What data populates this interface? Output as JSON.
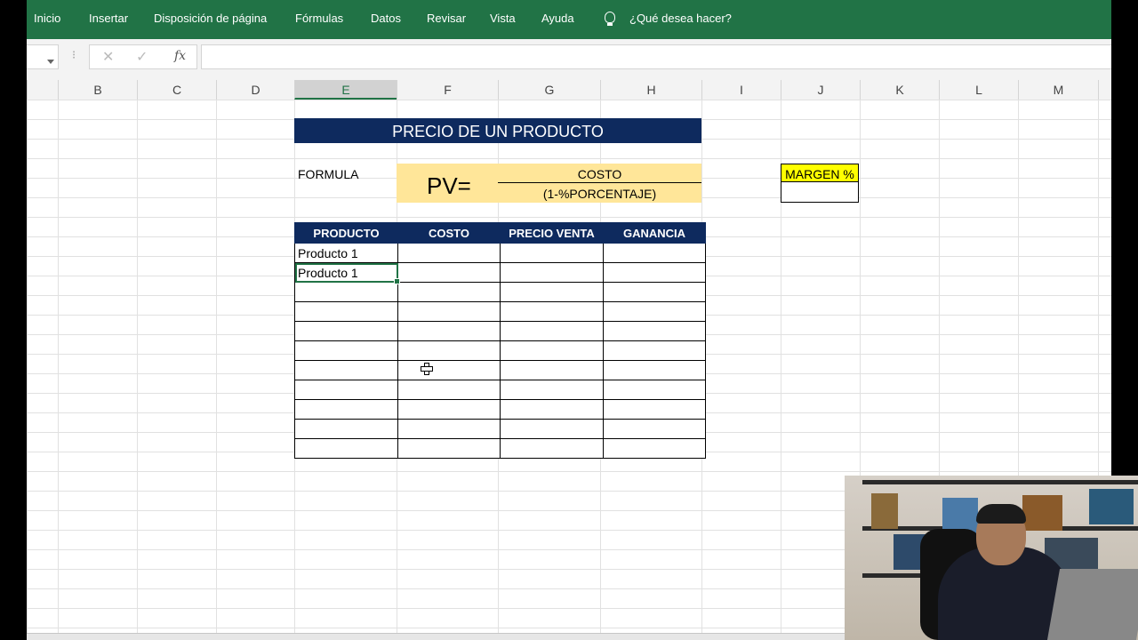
{
  "ribbon": {
    "tabs": [
      "Inicio",
      "Insertar",
      "Disposición de página",
      "Fórmulas",
      "Datos",
      "Revisar",
      "Vista",
      "Ayuda"
    ],
    "tell_me": "¿Qué desea hacer?"
  },
  "formula_bar": {
    "cancel_symbol": "✕",
    "enter_symbol": "✓",
    "fx_label": "fx",
    "value": ""
  },
  "columns": [
    "B",
    "C",
    "D",
    "E",
    "F",
    "G",
    "H",
    "I",
    "J",
    "K",
    "L",
    "M"
  ],
  "selected_column": "E",
  "sheet": {
    "title": "PRECIO DE UN PRODUCTO",
    "formula_label": "FORMULA",
    "pv_label": "PV=",
    "numerator": "COSTO",
    "denominator": "(1-%PORCENTAJE)",
    "margin_label": "MARGEN %",
    "margin_value": "",
    "table": {
      "headers": [
        "PRODUCTO",
        "COSTO",
        "PRECIO VENTA",
        "GANANCIA"
      ],
      "rows": [
        [
          "Producto 1",
          "",
          "",
          ""
        ],
        [
          "Producto 1",
          "",
          "",
          ""
        ],
        [
          "",
          "",
          "",
          ""
        ],
        [
          "",
          "",
          "",
          ""
        ],
        [
          "",
          "",
          "",
          ""
        ],
        [
          "",
          "",
          "",
          ""
        ],
        [
          "",
          "",
          "",
          ""
        ],
        [
          "",
          "",
          "",
          ""
        ],
        [
          "",
          "",
          "",
          ""
        ],
        [
          "",
          "",
          "",
          ""
        ],
        [
          "",
          "",
          "",
          ""
        ]
      ]
    }
  },
  "colors": {
    "ribbon": "#217346",
    "header_navy": "#0e2a5e",
    "formula_fill": "#ffe699",
    "margin_fill": "#ffff00"
  }
}
